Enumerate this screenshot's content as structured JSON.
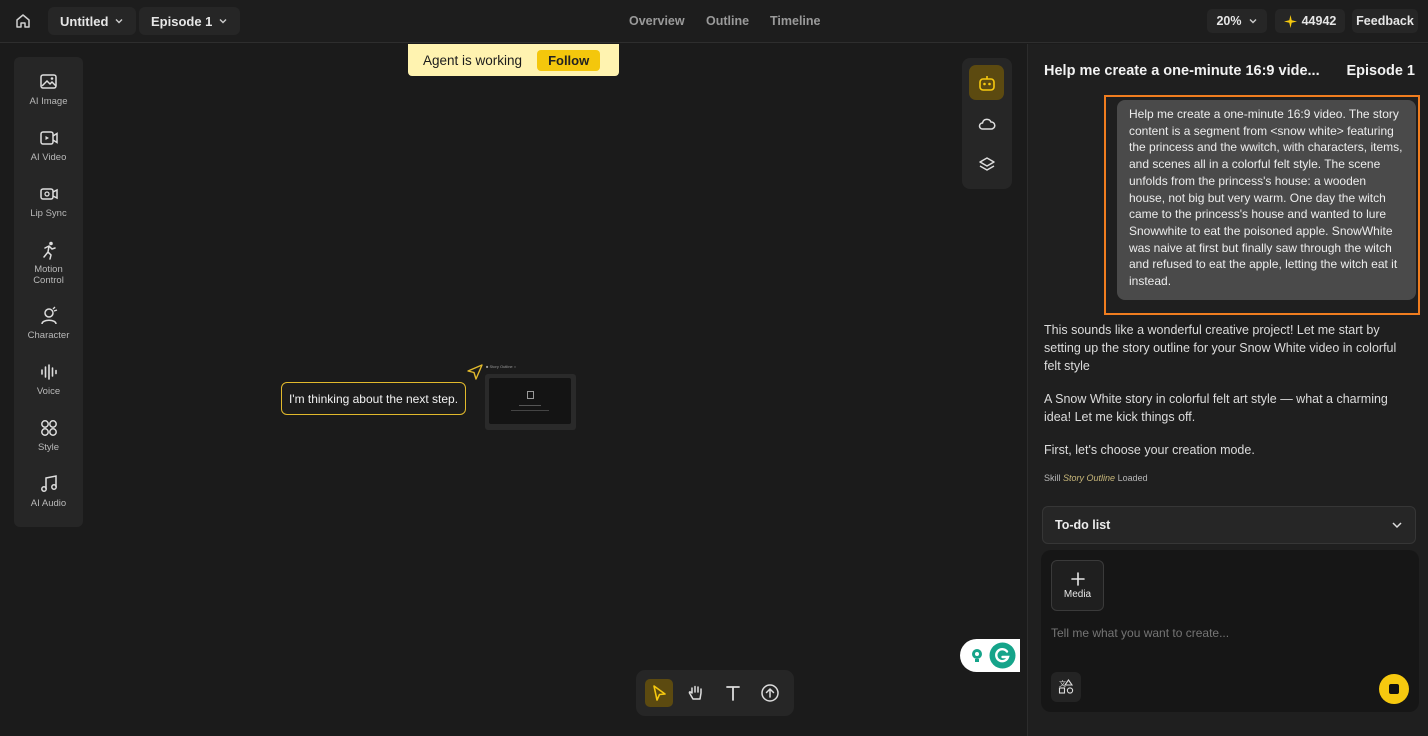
{
  "topbar": {
    "project_name": "Untitled",
    "episode": "Episode 1",
    "tabs": [
      "Overview",
      "Outline",
      "Timeline"
    ],
    "zoom": "20%",
    "credits": "44942",
    "feedback": "Feedback"
  },
  "left_tools": [
    {
      "label": "AI Image",
      "icon": "image-icon"
    },
    {
      "label": "AI Video",
      "icon": "video-icon"
    },
    {
      "label": "Lip Sync",
      "icon": "lip-sync-icon"
    },
    {
      "label": "Motion Control",
      "icon": "motion-icon"
    },
    {
      "label": "Character",
      "icon": "character-icon"
    },
    {
      "label": "Voice",
      "icon": "voice-icon"
    },
    {
      "label": "Style",
      "icon": "style-icon"
    },
    {
      "label": "AI Audio",
      "icon": "audio-icon"
    }
  ],
  "agent_banner": {
    "text": "Agent is working",
    "follow": "Follow"
  },
  "canvas": {
    "thinking": "I'm thinking about the next step."
  },
  "panel": {
    "title": "Help me create a one-minute 16:9 vide...",
    "episode": "Episode 1",
    "user_message": "Help me create a one-minute 16:9 video. The story content is a segment from <snow white> featuring the princess and the wwitch, with characters, items, and scenes all in a colorful felt style. The scene unfolds from the princess's house: a wooden house, not big but very warm. One day the witch came to the princess's house and wanted to lure Snowwhite to eat the poisoned apple. SnowWhite was naive at first but finally saw through the witch and refused to eat the apple, letting the witch eat it instead.",
    "ai_messages": [
      "This sounds like a wonderful creative project! Let me start by setting up the story outline for your Snow White video in colorful felt style",
      "A Snow White story in colorful felt art style — what a charming idea! Let me kick things off.",
      "First, let's choose your creation mode."
    ],
    "skill_prefix": "Skill",
    "skill_name": "Story Outline",
    "skill_suffix": "Loaded",
    "todo": "To-do list",
    "media": "Media",
    "prompt_placeholder": "Tell me what you want to create..."
  },
  "colors": {
    "accent": "#f6c90f",
    "highlight_outline": "#f07d1f",
    "banner_bg": "#fff3b0"
  }
}
